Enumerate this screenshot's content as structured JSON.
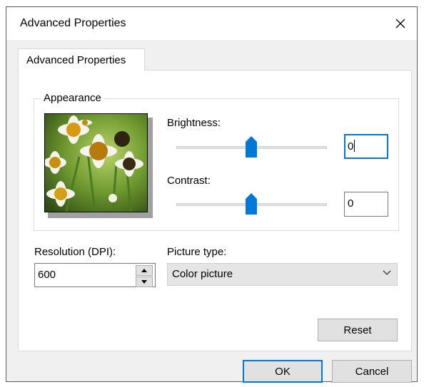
{
  "window": {
    "title": "Advanced Properties",
    "close_icon": "close-icon"
  },
  "tabs": [
    {
      "label": "Advanced Properties",
      "selected": true
    }
  ],
  "appearance": {
    "group_label": "Appearance",
    "brightness": {
      "label": "Brightness:",
      "value": "0"
    },
    "contrast": {
      "label": "Contrast:",
      "value": "0"
    },
    "accent_color": "#0078d7"
  },
  "resolution": {
    "label": "Resolution (DPI):",
    "value": "600"
  },
  "picture_type": {
    "label": "Picture type:",
    "selected": "Color picture"
  },
  "buttons": {
    "reset": "Reset",
    "ok": "OK",
    "cancel": "Cancel"
  }
}
